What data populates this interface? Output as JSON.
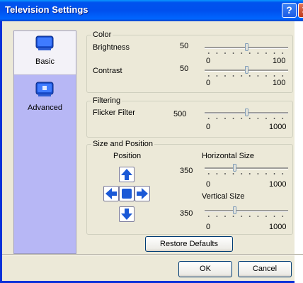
{
  "window": {
    "title": "Television Settings",
    "help_glyph": "?",
    "close_glyph": "✕"
  },
  "sidebar": {
    "items": [
      {
        "label": "Basic",
        "icon": "monitor-icon",
        "selected": true
      },
      {
        "label": "Advanced",
        "icon": "monitor-advanced-icon",
        "selected": false
      }
    ]
  },
  "color_group": {
    "title": "Color",
    "brightness": {
      "label": "Brightness",
      "value": "50",
      "min": "0",
      "max": "100",
      "fraction": 0.5
    },
    "contrast": {
      "label": "Contrast",
      "value": "50",
      "min": "0",
      "max": "100",
      "fraction": 0.5
    }
  },
  "filtering_group": {
    "title": "Filtering",
    "flicker": {
      "label": "Flicker Filter",
      "value": "500",
      "min": "0",
      "max": "1000",
      "fraction": 0.5
    }
  },
  "size_position_group": {
    "title": "Size and Position",
    "position_label": "Position",
    "horizontal": {
      "label": "Horizontal Size",
      "value": "350",
      "min": "0",
      "max": "1000",
      "fraction": 0.35
    },
    "vertical": {
      "label": "Vertical Size",
      "value": "350",
      "min": "0",
      "max": "1000",
      "fraction": 0.35
    }
  },
  "buttons": {
    "restore": "Restore Defaults",
    "ok": "OK",
    "cancel": "Cancel"
  },
  "colors": {
    "title_bar": "#0053ee",
    "sidebar": "#b7b7f5",
    "dialog": "#ece9d8",
    "arrow": "#1b59d6"
  }
}
